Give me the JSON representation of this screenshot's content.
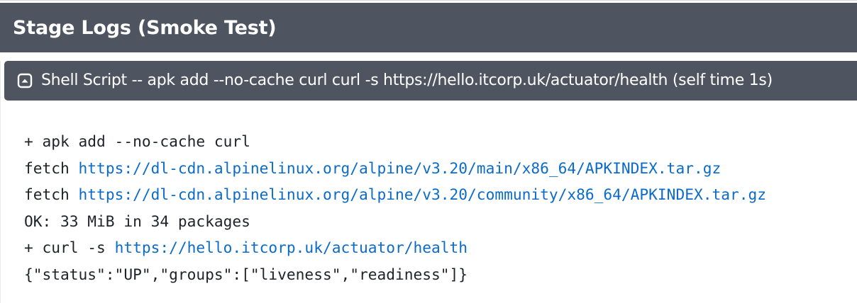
{
  "page": {
    "title": "Stage Logs (Smoke Test)"
  },
  "step": {
    "toggle_icon": "collapse-toggle-icon",
    "title": "Shell Script -- apk add --no-cache curl curl -s https://hello.itcorp.uk/actuator/health (self time 1s)"
  },
  "log": {
    "lines": [
      {
        "prefix": "+ apk add --no-cache curl",
        "link": ""
      },
      {
        "prefix": "fetch ",
        "link": "https://dl-cdn.alpinelinux.org/alpine/v3.20/main/x86_64/APKINDEX.tar.gz"
      },
      {
        "prefix": "fetch ",
        "link": "https://dl-cdn.alpinelinux.org/alpine/v3.20/community/x86_64/APKINDEX.tar.gz"
      },
      {
        "prefix": "OK: 33 MiB in 34 packages",
        "link": ""
      },
      {
        "prefix": "+ curl -s ",
        "link": "https://hello.itcorp.uk/actuator/health"
      },
      {
        "prefix": "{\"status\":\"UP\",\"groups\":[\"liveness\",\"readiness\"]}",
        "link": ""
      }
    ]
  },
  "colors": {
    "header_bg": "#4e5560",
    "link": "#0b6bcb",
    "text": "#1f2328"
  }
}
